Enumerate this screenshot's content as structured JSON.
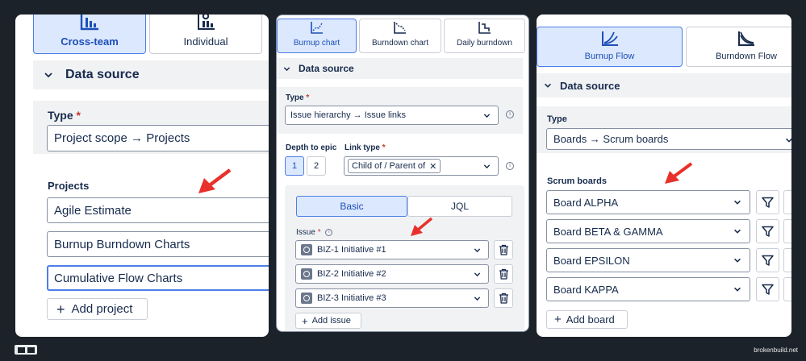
{
  "panel1": {
    "tabs": [
      {
        "label": "Cross-team",
        "selected": true
      },
      {
        "label": "Individual",
        "selected": false
      }
    ],
    "section_title": "Data source",
    "type_label": "Type",
    "required_mark": "*",
    "type_value": "Project scope → Projects",
    "projects_label": "Projects",
    "projects": [
      "Agile Estimate",
      "Burnup Burndown Charts",
      "Cumulative Flow Charts"
    ],
    "add_label": "Add project"
  },
  "panel2": {
    "tabs": [
      {
        "label": "Burnup chart",
        "selected": true
      },
      {
        "label": "Burndown chart",
        "selected": false
      },
      {
        "label": "Daily burndown",
        "selected": false
      }
    ],
    "section_title": "Data source",
    "type_label": "Type",
    "required_mark": "*",
    "type_value": "Issue hierarchy → Issue links",
    "depth_label": "Depth to epic",
    "depth_options": [
      "1",
      "2"
    ],
    "link_type_label": "Link type",
    "link_type_chip": "Child of / Parent of",
    "mode_tabs": [
      {
        "label": "Basic",
        "selected": true
      },
      {
        "label": "JQL",
        "selected": false
      }
    ],
    "issue_label": "Issue",
    "issues": [
      "BIZ-1 Initiative #1",
      "BIZ-2 Initiative #2",
      "BIZ-3 Initiative #3"
    ],
    "add_label": "Add issue"
  },
  "panel3": {
    "tabs": [
      {
        "label": "Burnup Flow",
        "selected": true
      },
      {
        "label": "Burndown Flow",
        "selected": false
      }
    ],
    "section_title": "Data source",
    "type_label": "Type",
    "type_value": "Boards → Scrum boards",
    "boards_label": "Scrum boards",
    "boards": [
      "Board ALPHA",
      "Board BETA & GAMMA",
      "Board EPSILON",
      "Board KAPPA"
    ],
    "add_label": "Add board"
  },
  "footer": {
    "site": "brokenbuild.net"
  },
  "colors": {
    "accent": "#4c7ee8",
    "selected_bg": "#dce8fd",
    "arrow": "#e8312a",
    "required": "#c9372c",
    "frame": "#1c2229"
  }
}
